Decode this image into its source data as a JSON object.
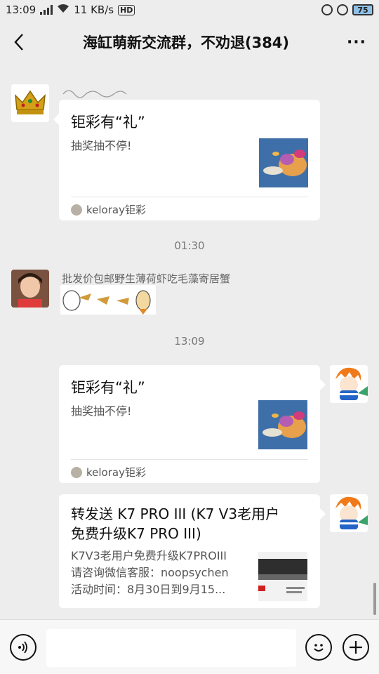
{
  "status": {
    "time": "13:09",
    "network_speed": "11 KB/s",
    "hd_label": "HD",
    "battery": "75"
  },
  "header": {
    "title": "海缸萌新交流群，不劝退(384)",
    "more": "···"
  },
  "messages": [
    {
      "card": {
        "title": "钜彩有“礼”",
        "desc": "抽奖抽不停!",
        "source": "keloray钜彩"
      }
    },
    {
      "timestamp": "01:30"
    },
    {
      "sender": "批发价包邮野生薄荷虾吃毛藻寄居蟹"
    },
    {
      "timestamp": "13:09"
    },
    {
      "card": {
        "title": "钜彩有“礼”",
        "desc": "抽奖抽不停!",
        "source": "keloray钜彩"
      }
    },
    {
      "card": {
        "title_line1": "转发送 K7 PRO III (K7 V3老用户",
        "title_line2": "免费升级K7 PRO III)",
        "desc_line1": "K7V3老用户免费升级K7PROIII",
        "desc_line2": "请咨询微信客服：noopsychen",
        "desc_line3": "活动时间：8月30日到9月15..."
      }
    }
  ],
  "colors": {
    "background": "#ededed",
    "card": "#ffffff",
    "bottom_bar": "#f7f7f7"
  },
  "icons": [
    "back-arrow-icon",
    "more-icon",
    "voice-icon",
    "emoji-icon",
    "plus-icon",
    "crown-icon"
  ]
}
